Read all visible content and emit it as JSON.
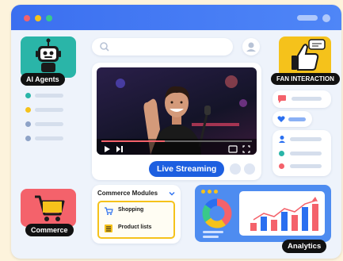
{
  "labels": {
    "ai_agents": "AI Agents",
    "fan_interaction": "FAN INTERACTION",
    "live_streaming": "Live Streaming",
    "commerce": "Commerce",
    "analytics": "Analytics"
  },
  "commerce_modules": {
    "title": "Commerce Modules",
    "items": [
      "Shopping",
      "Product lists"
    ]
  },
  "icons": {
    "robot": "robot-icon",
    "thumbs_up": "thumbs-up-icon",
    "cart": "shopping-cart-icon",
    "play": "play-icon",
    "next": "skip-next-icon",
    "search": "search-icon",
    "user": "user-icon"
  },
  "colors": {
    "titlebar": "#3b6ff0",
    "ai_tile": "#2ab5a8",
    "fan_tile": "#f5c21b",
    "commerce_tile": "#f4626b",
    "live_pill": "#1d5fe0",
    "analytics_bg": "#4e8cf0"
  },
  "window_dots": [
    "#f4626b",
    "#f5c21b",
    "#39c98a"
  ],
  "video": {
    "progress": 0.42
  },
  "analytics_chart": {
    "bars": [
      0.25,
      0.45,
      0.35,
      0.6,
      0.5,
      0.75,
      0.85
    ],
    "donut": [
      0.4,
      0.25,
      0.2,
      0.15
    ],
    "donut_colors": [
      "#f4626b",
      "#f5c21b",
      "#39c98a",
      "#2a6ff0"
    ]
  }
}
